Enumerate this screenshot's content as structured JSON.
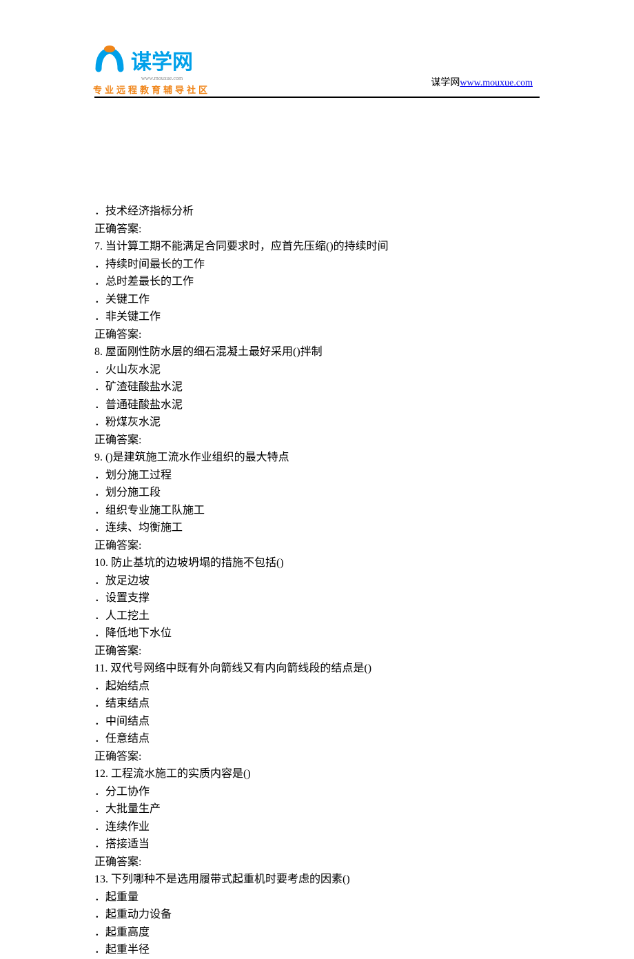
{
  "header": {
    "logo_chinese": "谋学网",
    "logo_url_small": "www.mouxue.com",
    "logo_subtitle": "专业远程教育辅导社区",
    "right_text_prefix": "谋学网",
    "right_link": "www.mouxue.com"
  },
  "lines": [
    "．技术经济指标分析",
    "正确答案:",
    "7.   当计算工期不能满足合同要求时，应首先压缩()的持续时间",
    "．持续时间最长的工作",
    "．总时差最长的工作",
    "．关键工作",
    "．非关键工作",
    "正确答案:",
    "8.   屋面刚性防水层的细石混凝土最好采用()拌制",
    "．火山灰水泥",
    "．矿渣硅酸盐水泥",
    "．普通硅酸盐水泥",
    "．粉煤灰水泥",
    "正确答案:",
    "9.   ()是建筑施工流水作业组织的最大特点",
    "．划分施工过程",
    "．划分施工段",
    "．组织专业施工队施工",
    "．连续、均衡施工",
    "正确答案:",
    "10.   防止基坑的边坡坍塌的措施不包括()",
    "．放足边坡",
    "．设置支撑",
    "．人工挖土",
    "．降低地下水位",
    "正确答案:",
    "11.   双代号网络中既有外向箭线又有内向箭线段的结点是()",
    "．起始结点",
    "．结束结点",
    "．中间结点",
    "．任意结点",
    "正确答案:",
    "12.   工程流水施工的实质内容是()",
    "．分工协作",
    "．大批量生产",
    "．连续作业",
    "．搭接适当",
    "正确答案:",
    "13.   下列哪种不是选用履带式起重机时要考虑的因素()",
    "．起重量",
    "．起重动力设备",
    "．起重高度",
    "．起重半径"
  ]
}
